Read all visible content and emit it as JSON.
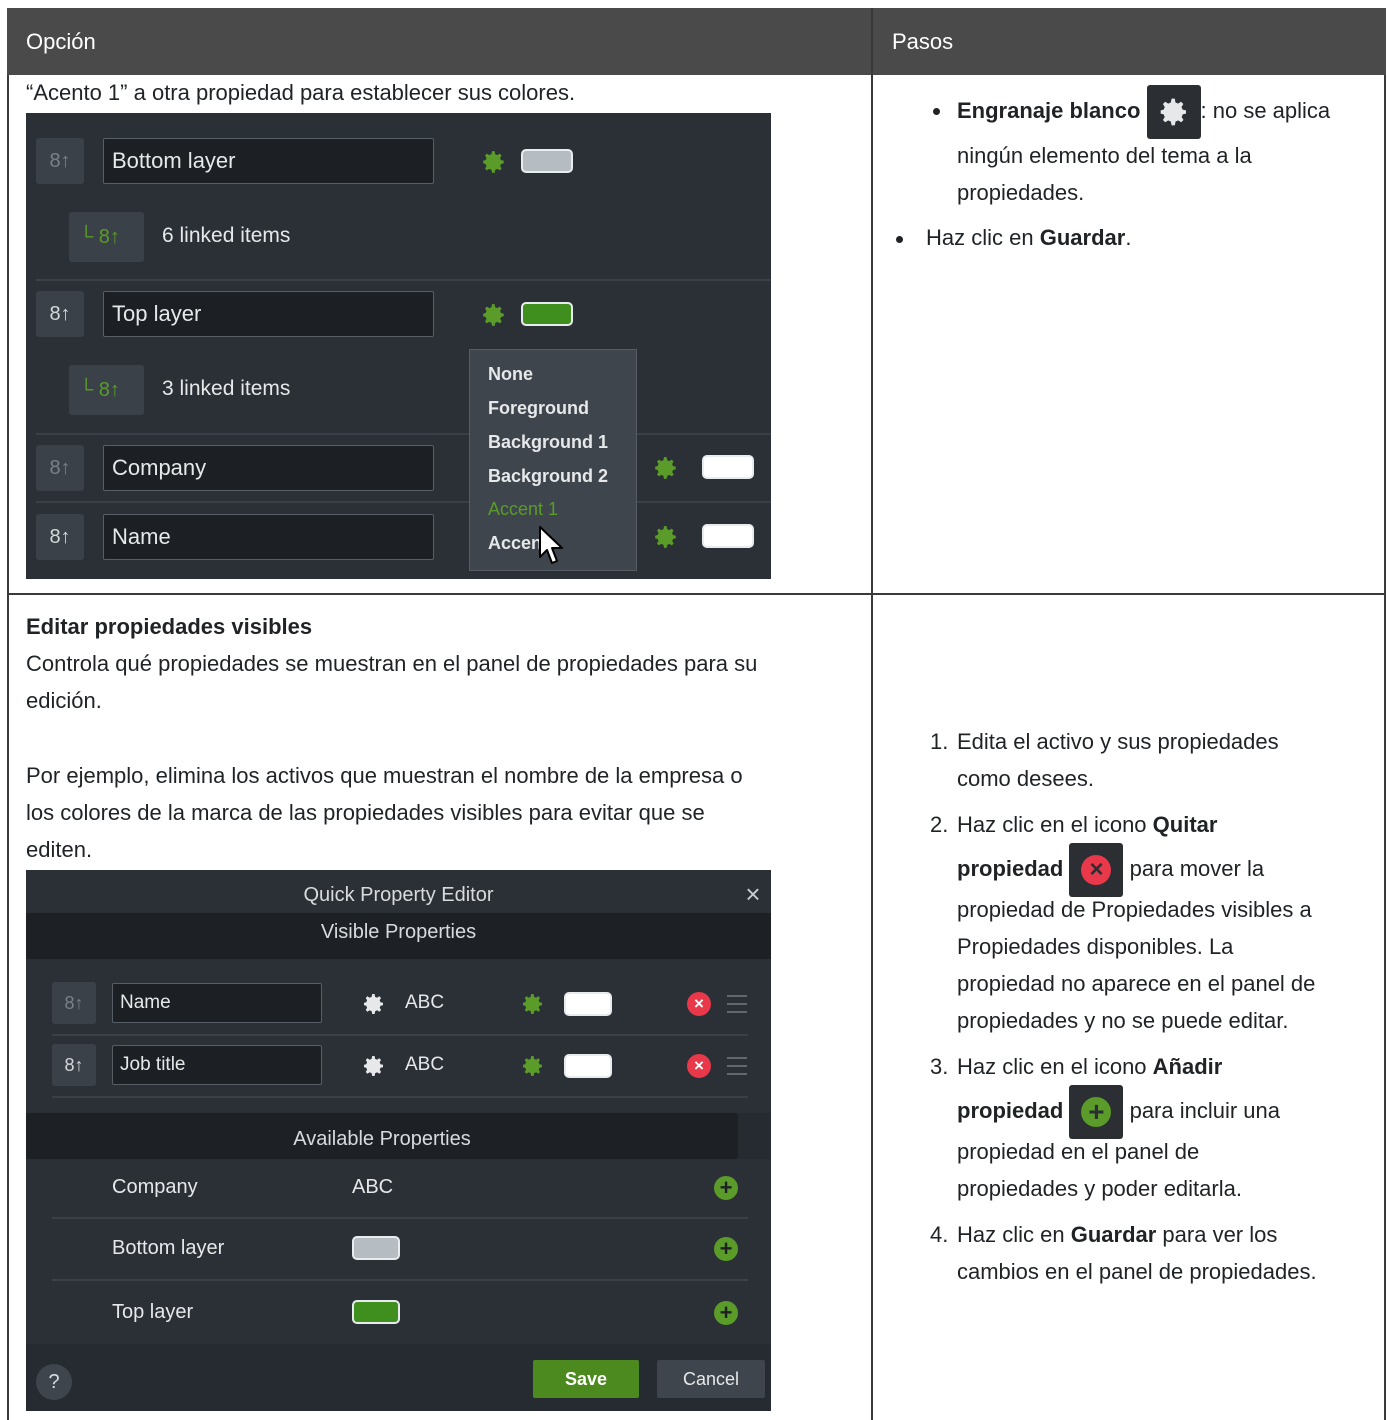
{
  "table": {
    "headers": {
      "option": "Opción",
      "steps": "Pasos"
    },
    "row1": {
      "intro_text": "“Acento 1” a otra propiedad para establecer sus colores.",
      "steps": {
        "gear_item_bold": "Engranaje blanco",
        "gear_item_rest1": ": no se aplica",
        "gear_item_rest2": "ningún elemento del tema a la",
        "gear_item_rest3": "propiedades.",
        "save_prefix": "Haz clic en ",
        "save_bold": "Guardar",
        "save_suffix": "."
      }
    },
    "row2": {
      "title": "Editar propiedades visibles",
      "desc_line1": "Controla qué propiedades se muestran en el panel de propiedades para su",
      "desc_line2": "edición.",
      "example_line1": "Por ejemplo, elimina los activos que muestran el nombre de la empresa o",
      "example_line2": "los colores de la marca de las propiedades visibles para evitar que se",
      "example_line3": "editen.",
      "steps": {
        "s1_num": "1.",
        "s1_line1": "Edita el activo y sus propiedades",
        "s1_line2": "como desees.",
        "s2_num": "2.",
        "s2_prefix": "Haz clic en el icono ",
        "s2_bold1": "Quitar",
        "s2_bold2": "propiedad",
        "s2_after_icon": " para mover la",
        "s2_line3": "propiedad de Propiedades visibles a",
        "s2_line4": "Propiedades disponibles. La",
        "s2_line5": "propiedad no aparece en el panel de",
        "s2_line6": "propiedades y no se puede editar.",
        "s3_num": "3.",
        "s3_prefix": "Haz clic en el icono ",
        "s3_bold1": "Añadir",
        "s3_bold2": "propiedad",
        "s3_after_icon": " para incluir una",
        "s3_line3": "propiedad en el panel de",
        "s3_line4": "propiedades y poder editarla.",
        "s4_num": "4.",
        "s4_prefix": "Haz clic en ",
        "s4_bold": "Guardar",
        "s4_suffix": " para ver los",
        "s4_line2": "cambios en el panel de propiedades."
      }
    }
  },
  "screenshot1": {
    "rows": [
      {
        "label": "Bottom layer",
        "linked_text": "6 linked items",
        "swatch_color": "#b5bcc2"
      },
      {
        "label": "Top layer",
        "linked_text": "3 linked items",
        "swatch_color": "#3f8f1e"
      },
      {
        "label": "Company",
        "swatch_color": "#ffffff"
      },
      {
        "label": "Name",
        "swatch_color": "#ffffff"
      }
    ],
    "menu": {
      "items": [
        "None",
        "Foreground",
        "Background 1",
        "Background 2",
        "Accent 1",
        "Accen"
      ],
      "active_index": 4
    },
    "icons": {
      "link": "link-arrow-icon",
      "linked": "linked-items-icon",
      "gear": "gear-icon",
      "cursor": "mouse-pointer-icon"
    }
  },
  "screenshot2": {
    "title": "Quick Property Editor",
    "close_glyph": "×",
    "visible_header": "Visible Properties",
    "visible": [
      {
        "label": "Name",
        "value": "ABC",
        "swatch_color": "#ffffff"
      },
      {
        "label": "Job title",
        "value": "ABC",
        "swatch_color": "#ffffff"
      }
    ],
    "available_header": "Available Properties",
    "available": [
      {
        "label": "Company",
        "value": "ABC"
      },
      {
        "label": "Bottom layer",
        "swatch_color": "#b5bcc2"
      },
      {
        "label": "Top layer",
        "swatch_color": "#3f8f1e"
      }
    ],
    "help": "?",
    "save": "Save",
    "cancel": "Cancel",
    "colors": {
      "accent_green": "#5a9b2a",
      "remove_red": "#e8384a"
    }
  }
}
